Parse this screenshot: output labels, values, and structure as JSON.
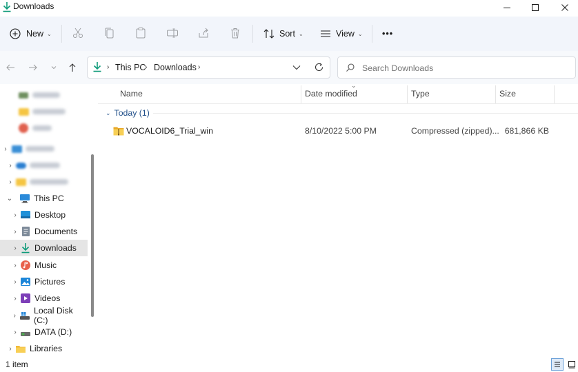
{
  "window": {
    "title": "Downloads"
  },
  "toolbar": {
    "new_label": "New",
    "sort_label": "Sort",
    "view_label": "View",
    "more_label": "•••"
  },
  "address": {
    "crumbs": [
      "This PC",
      "Downloads"
    ],
    "search_placeholder": "Search Downloads"
  },
  "nav": {
    "items": [
      {
        "label": "This PC"
      },
      {
        "label": "Desktop"
      },
      {
        "label": "Documents"
      },
      {
        "label": "Downloads"
      },
      {
        "label": "Music"
      },
      {
        "label": "Pictures"
      },
      {
        "label": "Videos"
      },
      {
        "label": "Local Disk (C:)"
      },
      {
        "label": "DATA (D:)"
      },
      {
        "label": "Libraries"
      }
    ]
  },
  "columns": {
    "name": "Name",
    "date": "Date modified",
    "type": "Type",
    "size": "Size"
  },
  "group": {
    "label": "Today (1)"
  },
  "files": [
    {
      "name": "VOCALOID6_Trial_win",
      "date": "8/10/2022 5:00 PM",
      "type": "Compressed (zipped)...",
      "size": "681,866 KB"
    }
  ],
  "status": {
    "count": "1 item"
  },
  "colors": {
    "accent": "#0f7b6c",
    "selected": "#e5e5e5",
    "group": "#22508a"
  }
}
